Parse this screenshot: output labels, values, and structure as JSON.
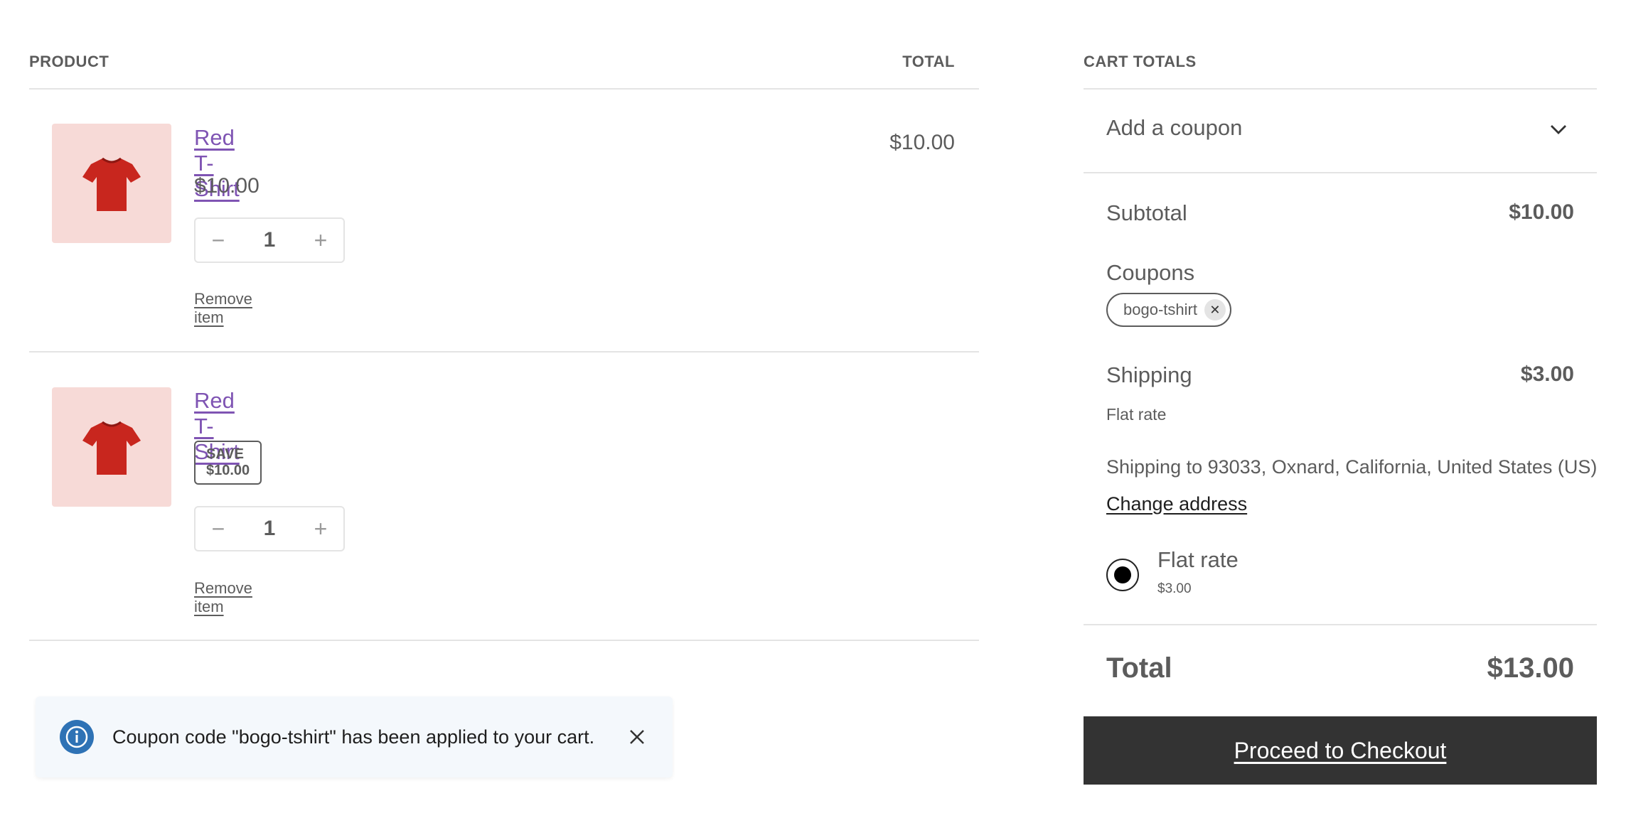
{
  "cart_table": {
    "header_product": "PRODUCT",
    "header_total": "TOTAL",
    "items": [
      {
        "name": "Red T-Shirt",
        "price": "$10.00",
        "quantity": "1",
        "line_total": "$10.00",
        "remove_label": "Remove item",
        "icons": {
          "decrease": "minus-icon",
          "increase": "plus-icon",
          "thumbnail": "t-shirt-icon"
        }
      },
      {
        "name": "Red T-Shirt",
        "badge": "SAVE $10.00",
        "quantity": "1",
        "remove_label": "Remove item",
        "icons": {
          "decrease": "minus-icon",
          "increase": "plus-icon",
          "thumbnail": "t-shirt-icon"
        }
      }
    ]
  },
  "notice": {
    "text": "Coupon code \"bogo-tshirt\" has been applied to your cart.",
    "icon": "info-icon",
    "close_icon": "close-icon"
  },
  "cart_totals": {
    "heading": "CART TOTALS",
    "add_coupon": "Add a coupon",
    "subtotal_label": "Subtotal",
    "subtotal_value": "$10.00",
    "coupons_label": "Coupons",
    "coupon_code": "bogo-tshirt",
    "shipping_label": "Shipping",
    "shipping_value": "$3.00",
    "shipping_method": "Flat rate",
    "shipping_to": "Shipping to 93033, Oxnard, California, United States (US)",
    "change_address": "Change address",
    "rate_option_label": "Flat rate",
    "rate_option_price": "$3.00",
    "total_label": "Total",
    "total_value": "$13.00",
    "checkout_label": "Proceed to Checkout"
  },
  "colors": {
    "link": "#7f54b3",
    "thumbnail_bg": "#f7dad7",
    "tshirt": "#c8261e",
    "checkout_bg": "#333333",
    "info_icon": "#2e72b5",
    "notice_bg": "#f4f8fc"
  }
}
